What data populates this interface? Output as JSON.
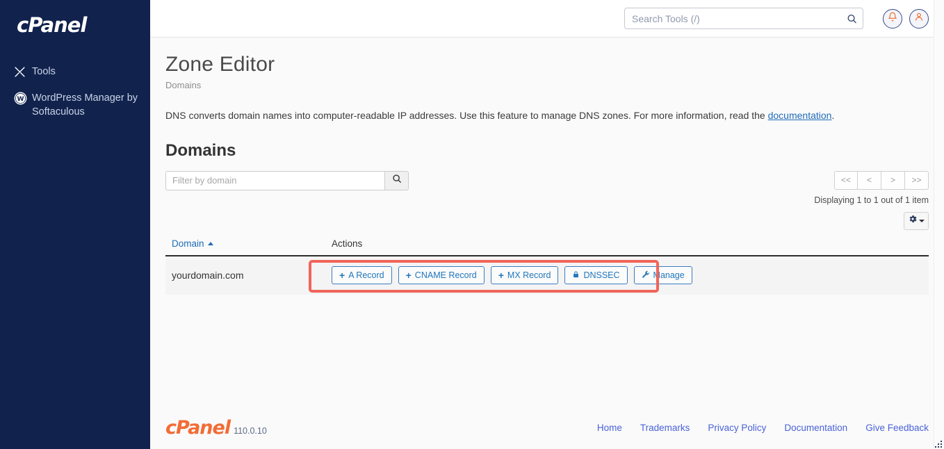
{
  "sidebar": {
    "brand": "cPanel",
    "items": [
      {
        "label": "Tools",
        "icon": "tools-icon"
      },
      {
        "label": "WordPress Manager by Softaculous",
        "icon": "wordpress-icon"
      }
    ]
  },
  "header": {
    "search_placeholder": "Search Tools (/)",
    "search_value": "",
    "notifications_icon": "bell-icon",
    "account_icon": "user-icon"
  },
  "page": {
    "title": "Zone Editor",
    "breadcrumb": "Domains",
    "intro_text": "DNS converts domain names into computer-readable IP addresses. Use this feature to manage DNS zones. For more information, read the ",
    "intro_link": "documentation",
    "intro_tail": "."
  },
  "domains_section": {
    "heading": "Domains",
    "filter_placeholder": "Filter by domain",
    "filter_value": "",
    "search_button_icon": "search-icon",
    "pagination": {
      "first": "<<",
      "prev": "<",
      "next": ">",
      "last": ">>"
    },
    "displaying_text": "Displaying 1 to 1 out of 1 item",
    "settings_button_icon": "gear-icon",
    "table": {
      "columns": [
        "Domain",
        "Actions"
      ],
      "sort_column": "Domain",
      "sort_direction": "ascending",
      "rows": [
        {
          "domain": "yourdomain.com",
          "actions": [
            {
              "label": "A Record",
              "icon": "plus-icon"
            },
            {
              "label": "CNAME Record",
              "icon": "plus-icon"
            },
            {
              "label": "MX Record",
              "icon": "plus-icon"
            },
            {
              "label": "DNSSEC",
              "icon": "lock-icon"
            },
            {
              "label": "Manage",
              "icon": "wrench-icon"
            }
          ]
        }
      ]
    }
  },
  "footer": {
    "brand": "cPanel",
    "version": "110.0.10",
    "links": [
      "Home",
      "Trademarks",
      "Privacy Policy",
      "Documentation",
      "Give Feedback"
    ]
  },
  "colors": {
    "sidebar_bg": "#11224d",
    "brand_orange": "#f26c36",
    "link_blue": "#1f6bb8",
    "annotation_red": "#f0645a",
    "row_bg": "#f4f4f4"
  }
}
